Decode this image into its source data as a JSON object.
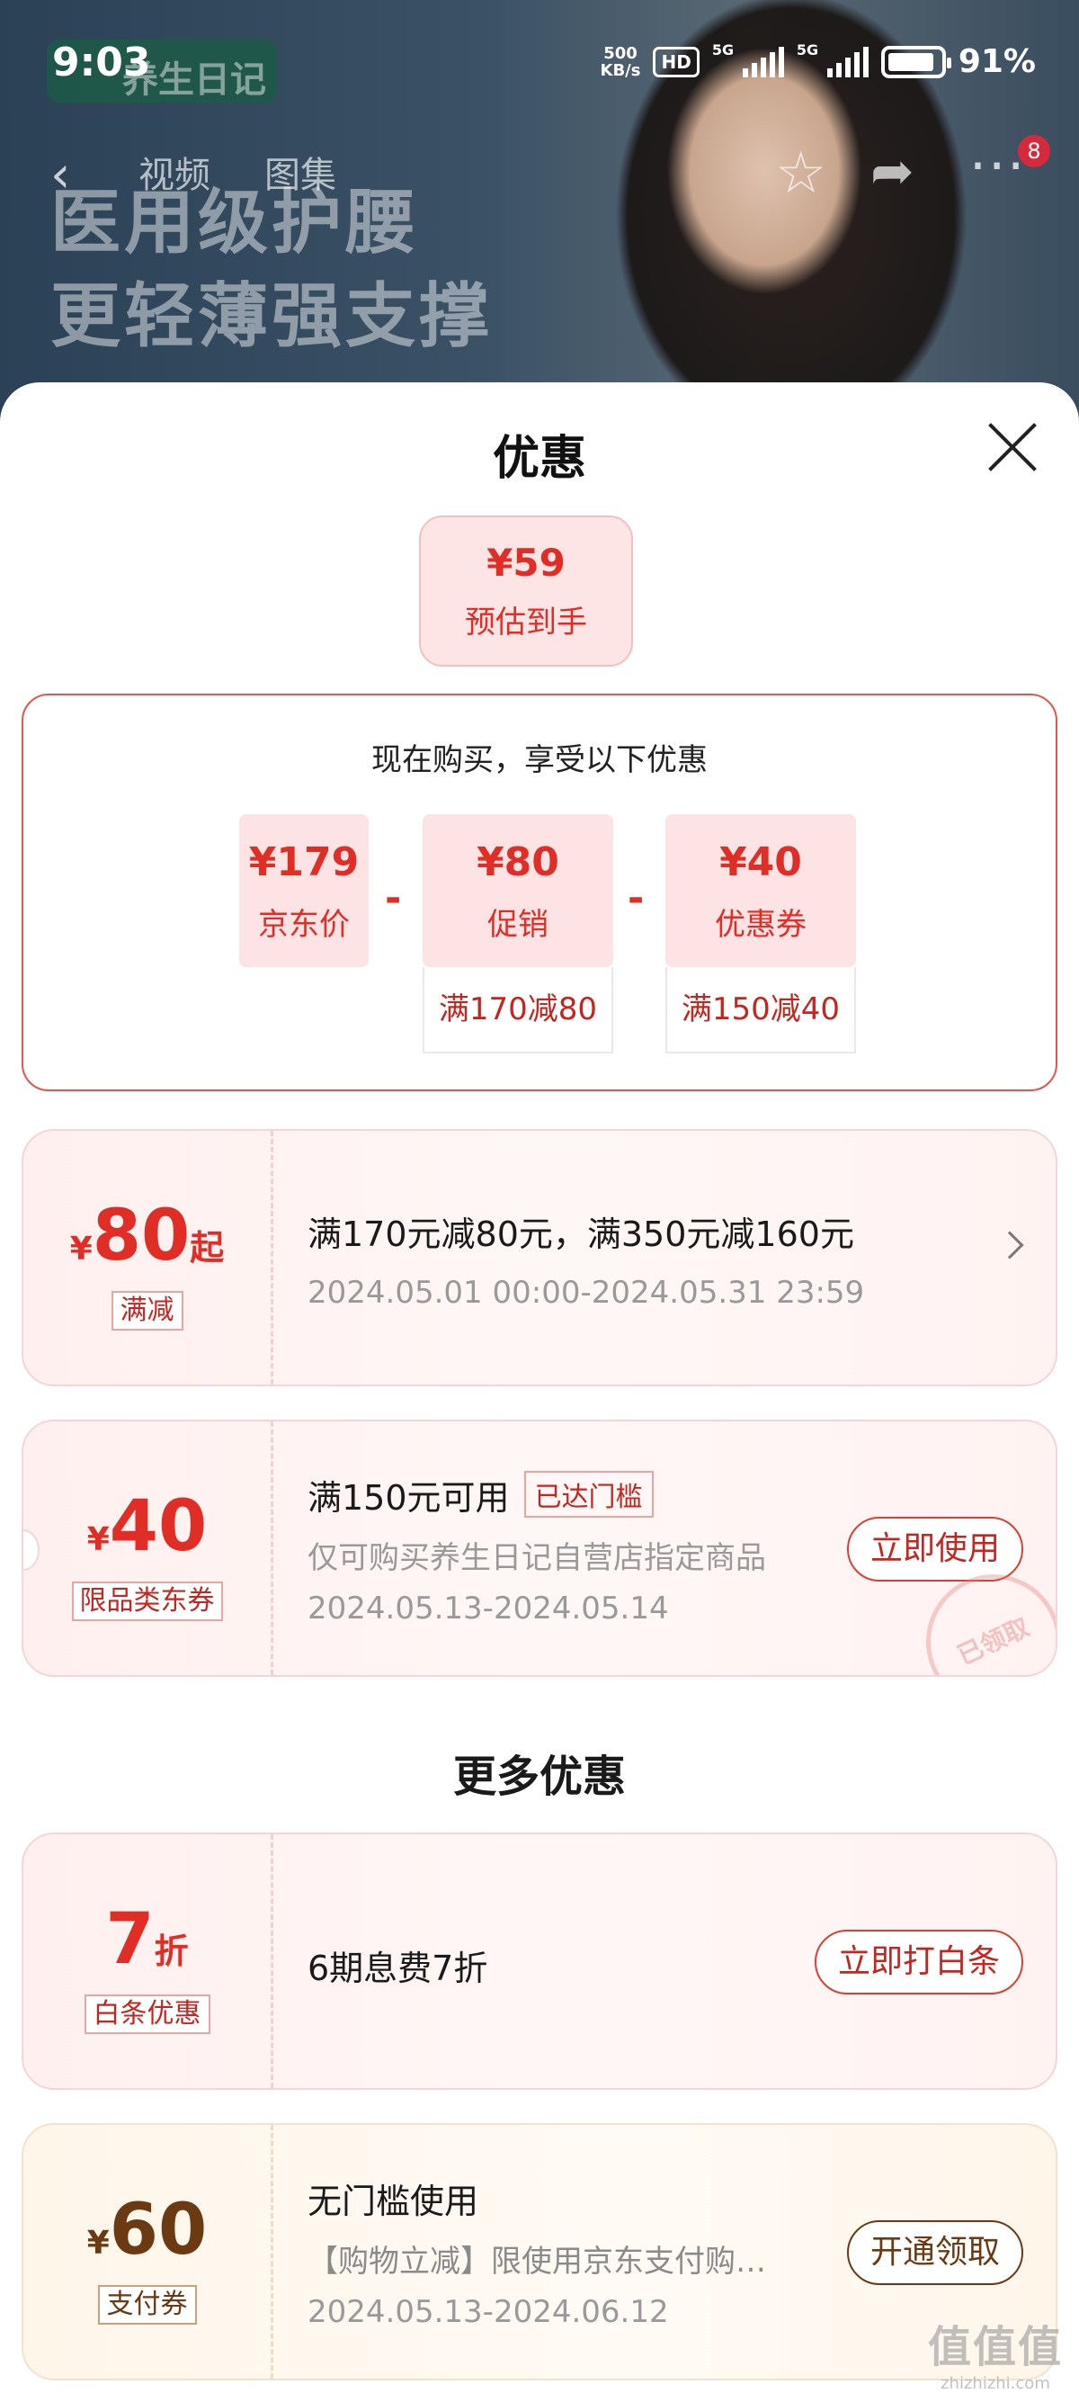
{
  "status_bar": {
    "time": "9:03",
    "net_speed": "500",
    "net_unit": "KB/s",
    "hd": "HD",
    "sig1": "5G",
    "sig2": "5G",
    "battery": "91%"
  },
  "hero": {
    "brand": "养生日记",
    "line1": "医用级护腰",
    "line2": "更轻薄强支撑"
  },
  "top_nav": {
    "tab_video": "视频",
    "tab_gallery": "图集",
    "badge": "8"
  },
  "sheet": {
    "title": "优惠",
    "estimate": {
      "value": "¥59",
      "label": "预估到手"
    },
    "breakdown": {
      "heading": "现在购买，享受以下优惠",
      "minus": "-",
      "items": [
        {
          "value": "¥179",
          "label": "京东价",
          "sub": ""
        },
        {
          "value": "¥80",
          "label": "促销",
          "sub": "满170减80"
        },
        {
          "value": "¥40",
          "label": "优惠券",
          "sub": "满150减40"
        }
      ]
    },
    "promo_card": {
      "cur": "¥",
      "num": "80",
      "suffix": "起",
      "tag": "满减",
      "title": "满170元减80元，满350元减160元",
      "period": "2024.05.01 00:00-2024.05.31 23:59"
    },
    "coupon_card": {
      "cur": "¥",
      "num": "40",
      "tag": "限品类东券",
      "title": "满150元可用",
      "reached": "已达门槛",
      "desc": "仅可购买养生日记自营店指定商品",
      "period": "2024.05.13-2024.05.14",
      "button": "立即使用",
      "stamp": "已领取"
    },
    "more_title": "更多优惠",
    "baitiao_card": {
      "num": "7",
      "suffix": "折",
      "tag": "白条优惠",
      "title": "6期息费7折",
      "button": "立即打白条"
    },
    "pay_card": {
      "cur": "¥",
      "num": "60",
      "tag": "支付券",
      "title": "无门槛使用",
      "desc": "【购物立减】限使用京东支付购…",
      "period": "2024.05.13-2024.06.12",
      "button": "开通领取"
    }
  },
  "watermark": {
    "main": "值值值",
    "sub": "zhizhizhi.com"
  },
  "colors": {
    "accent_red": "#e02d25",
    "brown": "#6b3a12"
  }
}
